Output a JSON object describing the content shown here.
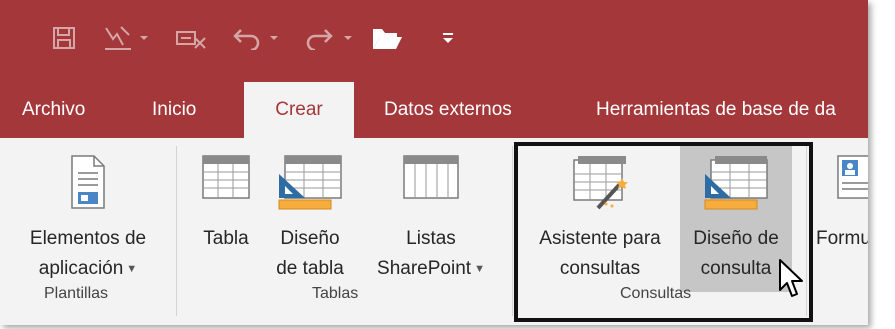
{
  "colors": {
    "accent": "#a4373a",
    "ribbon_bg": "#f3f3f3",
    "hover_bg": "#c6c6c6"
  },
  "qat": {
    "icons": [
      "save-icon",
      "view-icon",
      "customize-icon",
      "undo-icon",
      "redo-icon",
      "open-folder-icon",
      "more-icon"
    ]
  },
  "tabs": [
    {
      "label": "Archivo"
    },
    {
      "label": "Inicio"
    },
    {
      "label": "Crear",
      "selected": true
    },
    {
      "label": "Datos externos"
    },
    {
      "label": "Herramientas de base de da"
    }
  ],
  "ribbon": {
    "plantillas": {
      "label": "Plantillas",
      "elementos": {
        "line1": "Elementos de",
        "line2": "aplicación",
        "icon": "document-icon"
      }
    },
    "tablas": {
      "label": "Tablas",
      "tabla": {
        "line1": "Tabla",
        "icon": "table-icon"
      },
      "diseno_tabla": {
        "line1": "Diseño",
        "line2": "de tabla",
        "icon": "table-design-icon"
      },
      "listas": {
        "line1": "Listas",
        "line2": "SharePoint",
        "icon": "sharepoint-list-icon"
      }
    },
    "consultas": {
      "label": "Consultas",
      "asistente": {
        "line1": "Asistente para",
        "line2": "consultas",
        "icon": "query-wizard-icon"
      },
      "diseno_consulta": {
        "line1": "Diseño de",
        "line2": "consulta",
        "icon": "query-design-icon"
      }
    },
    "formularios": {
      "formulario": {
        "line1": "Formul",
        "icon": "form-icon"
      }
    }
  }
}
